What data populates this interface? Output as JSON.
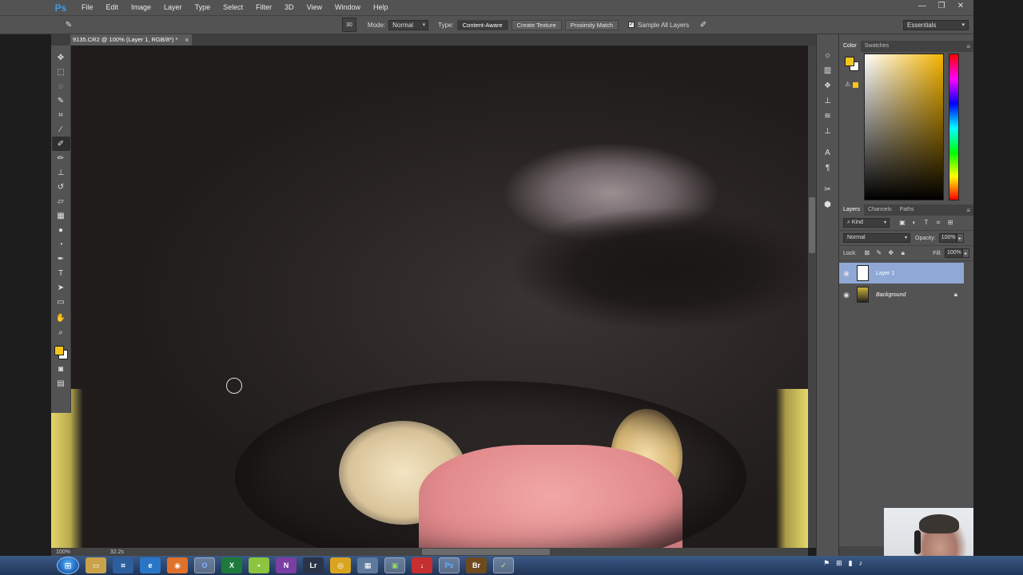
{
  "app": {
    "logo": "Ps"
  },
  "menu": [
    "File",
    "Edit",
    "Image",
    "Layer",
    "Type",
    "Select",
    "Filter",
    "3D",
    "View",
    "Window",
    "Help"
  ],
  "window_controls": [
    "—",
    "❐",
    "✕"
  ],
  "options": {
    "brush_size": "30",
    "mode_label": "Mode:",
    "mode_value": "Normal",
    "type_label": "Type:",
    "type_options": [
      "Content-Aware",
      "Create Texture",
      "Proximity Match"
    ],
    "sample_all_layers": "Sample All Layers",
    "workspace": "Essentials"
  },
  "document": {
    "tab_title": "9135.CR2 @ 100% (Layer 1, RGB/8*) *",
    "close": "×"
  },
  "status": {
    "zoom": "100%",
    "doc_info": "32.2s"
  },
  "panels": {
    "color_tabs": [
      "Color",
      "Swatches"
    ],
    "layers_tabs": [
      "Layers",
      "Channels",
      "Paths"
    ],
    "kind_filter": "Kind",
    "blend_mode": "Normal",
    "opacity_label": "Opacity:",
    "opacity_value": "100%",
    "lock_label": "Lock:",
    "fill_label": "Fill:",
    "fill_value": "100%",
    "layers": [
      {
        "name": "Layer 1",
        "selected": true
      },
      {
        "name": "Background",
        "selected": false,
        "locked": true
      }
    ],
    "footer_icons": [
      "link-icon",
      "fx-icon"
    ]
  },
  "colors": {
    "foreground": "#f5c518",
    "background": "#ffffff",
    "selection": "#8fa8d6"
  },
  "taskbar": {
    "icons": [
      "explorer",
      "network",
      "ie",
      "firefox",
      "outlook",
      "excel",
      "app-green",
      "onenote",
      "lightroom",
      "chrome",
      "app-grid",
      "camtasia",
      "download",
      "photoshop",
      "bridge",
      "app-check"
    ]
  }
}
